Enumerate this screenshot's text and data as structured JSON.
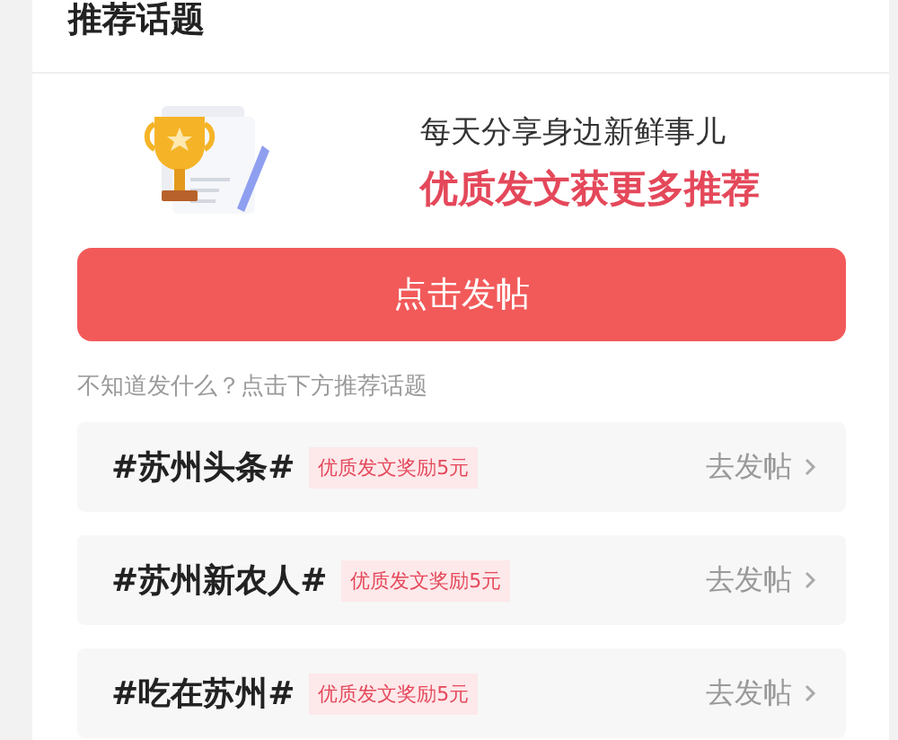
{
  "header": {
    "title": "推荐话题"
  },
  "promo": {
    "line_1": "每天分享身边新鲜事儿",
    "line_2": "优质发文获更多推荐"
  },
  "post_button": {
    "label": "点击发帖"
  },
  "hint": "不知道发什么？点击下方推荐话题",
  "topics": [
    {
      "name": "#苏州头条#",
      "badge": "优质发文奖励5元",
      "action": "去发帖"
    },
    {
      "name": "#苏州新农人#",
      "badge": "优质发文奖励5元",
      "action": "去发帖"
    },
    {
      "name": "#吃在苏州#",
      "badge": "优质发文奖励5元",
      "action": "去发帖"
    }
  ]
}
